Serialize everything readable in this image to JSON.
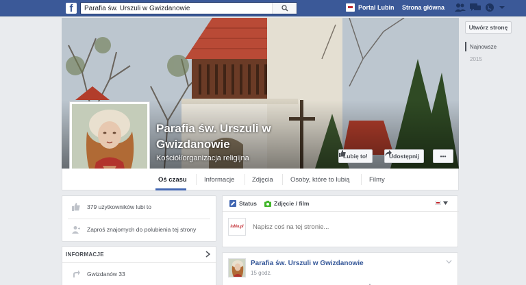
{
  "topbar": {
    "logo": "f",
    "search_value": "Parafia św. Urszuli w Gwizdanowie",
    "portal_label": "Portal Lubin",
    "home_label": "Strona główna"
  },
  "page": {
    "name": "Parafia św. Urszuli w Gwizdanowie",
    "category": "Kościół/organizacja religijna",
    "like_button": "Lubię to!",
    "share_button": "Udostępnij",
    "more_button": "•••"
  },
  "tabs": [
    {
      "label": "Oś czasu"
    },
    {
      "label": "Informacje"
    },
    {
      "label": "Zdjęcia"
    },
    {
      "label": "Osoby, które to lubią"
    },
    {
      "label": "Filmy"
    }
  ],
  "right_rail": {
    "create_page": "Utwórz stronę",
    "years": [
      "Najnowsze",
      "2015"
    ]
  },
  "likes_card": {
    "likes_text": "379 użytkowników lubi to",
    "invite_text": "Zaproś znajomych do polubienia tej strony"
  },
  "info_card": {
    "heading": "INFORMACJE",
    "address": "Gwizdanów 33"
  },
  "composer": {
    "status_tab": "Status",
    "photo_tab": "Zdjęcie / film",
    "placeholder": "Napisz coś na tej stronie...",
    "avatar_text": "lubin.pl"
  },
  "post": {
    "author": "Parafia św. Urszuli w Gwizdanowie",
    "time": "15 godz."
  },
  "colors": {
    "brand": "#3b5998",
    "link": "#365899",
    "accent": "#4267b2",
    "background": "#e9ebee"
  }
}
